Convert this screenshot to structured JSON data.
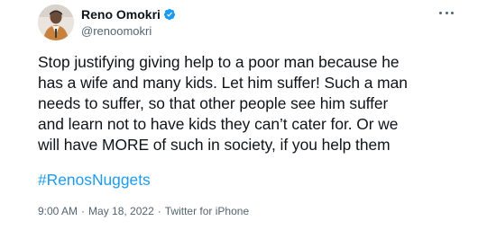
{
  "author": {
    "display_name": "Reno Omokri",
    "handle": "@renoomokri",
    "verified": true,
    "avatar_icon": "profile-photo"
  },
  "tweet": {
    "text": "Stop justifying giving help to a poor man because he\nhas a wife and many kids. Let him suffer! Such a man\nneeds to suffer, so that other people see him suffer\nand learn not to have kids they can’t cater for. Or we\nwill have MORE of such in society, if you help them",
    "hashtag": "#RenosNuggets"
  },
  "meta": {
    "time": "9:00 AM",
    "separator": "·",
    "date": "May 18, 2022",
    "source": "Twitter for iPhone"
  },
  "colors": {
    "link": "#1d9bf0",
    "secondary_text": "#536471",
    "primary_text": "#0f1419",
    "verified_badge": "#1d9bf0"
  }
}
